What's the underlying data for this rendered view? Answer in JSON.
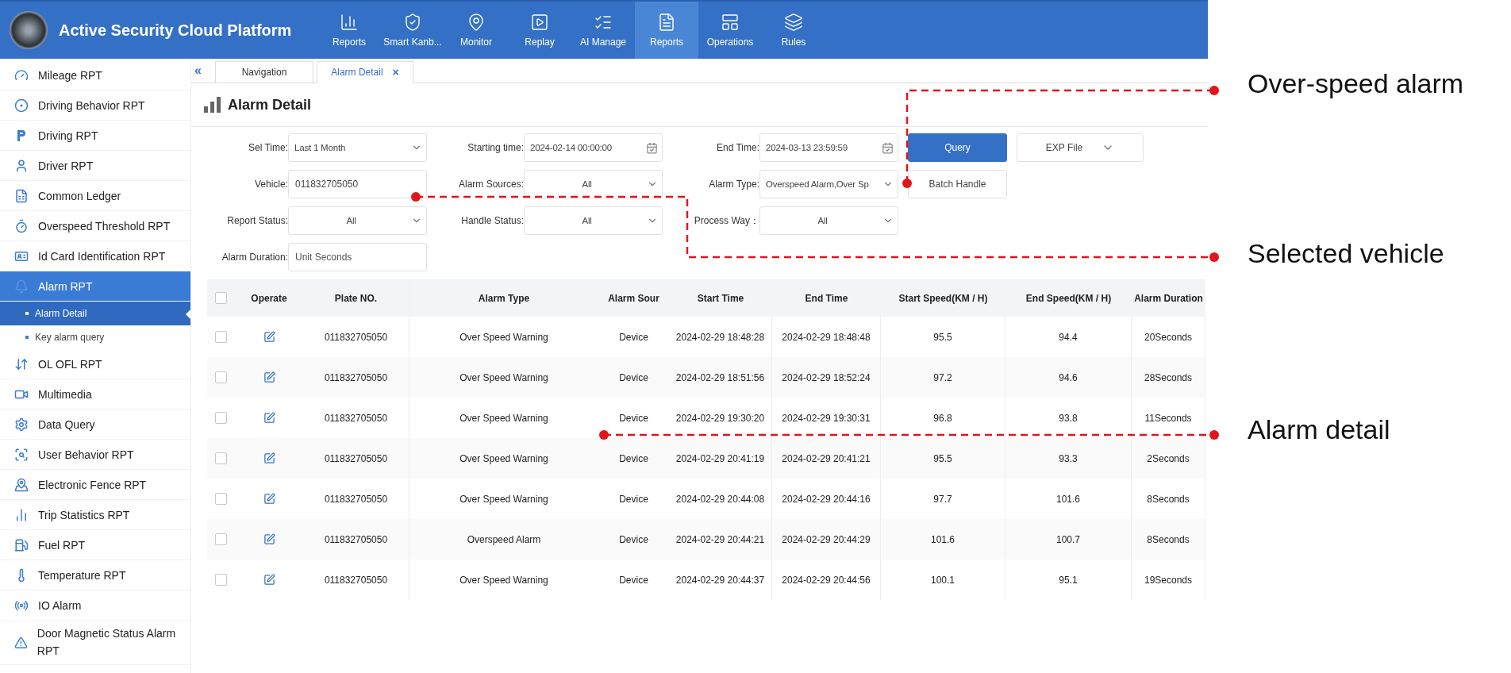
{
  "header": {
    "title": "Active Security Cloud Platform",
    "nav": [
      {
        "label": "Reports",
        "selected": false
      },
      {
        "label": "Smart Kanb...",
        "selected": false
      },
      {
        "label": "Monitor",
        "selected": false
      },
      {
        "label": "Replay",
        "selected": false
      },
      {
        "label": "AI Manage",
        "selected": false
      },
      {
        "label": "Reports",
        "selected": true
      },
      {
        "label": "Operations",
        "selected": false
      },
      {
        "label": "Rules",
        "selected": false
      }
    ]
  },
  "sidebar": {
    "items": [
      {
        "label": "Mileage RPT",
        "selected": false
      },
      {
        "label": "Driving Behavior RPT",
        "selected": false
      },
      {
        "label": "Driving RPT",
        "selected": false
      },
      {
        "label": "Driver RPT",
        "selected": false
      },
      {
        "label": "Common Ledger",
        "selected": false
      },
      {
        "label": "Overspeed Threshold RPT",
        "selected": false
      },
      {
        "label": "Id Card Identification RPT",
        "selected": false
      },
      {
        "label": "Alarm RPT",
        "selected": true,
        "children": [
          {
            "label": "Alarm Detail",
            "selected": true
          },
          {
            "label": "Key alarm query",
            "selected": false
          }
        ]
      },
      {
        "label": "OL OFL RPT",
        "selected": false
      },
      {
        "label": "Multimedia",
        "selected": false
      },
      {
        "label": "Data Query",
        "selected": false
      },
      {
        "label": "User Behavior RPT",
        "selected": false
      },
      {
        "label": "Electronic Fence RPT",
        "selected": false
      },
      {
        "label": "Trip Statistics RPT",
        "selected": false
      },
      {
        "label": "Fuel RPT",
        "selected": false
      },
      {
        "label": "Temperature RPT",
        "selected": false
      },
      {
        "label": "IO Alarm",
        "selected": false
      },
      {
        "label": "Door Magnetic Status Alarm RPT",
        "selected": false
      }
    ]
  },
  "tabs": {
    "collapse": "«",
    "items": [
      {
        "label": "Navigation",
        "selected": false
      },
      {
        "label": "Alarm Detail",
        "selected": true,
        "close": "×"
      }
    ]
  },
  "page_title": "Alarm Detail",
  "filter_rows": [
    {
      "fields": [
        {
          "label": "Sel Time:",
          "kind": "select",
          "value": "Last 1 Month",
          "centered": false
        },
        {
          "label": "Starting time:",
          "kind": "date",
          "value": "2024-02-14 00:00:00"
        },
        {
          "label": "End Time:",
          "kind": "date",
          "value": "2024-03-13 23:59:59"
        }
      ],
      "buttons": [
        {
          "label": "Query",
          "kind": "primary"
        },
        {
          "label": "EXP File",
          "kind": "dropdown"
        }
      ]
    },
    {
      "fields": [
        {
          "label": "Vehicle:",
          "kind": "input",
          "value": "011832705050"
        },
        {
          "label": "Alarm Sources:",
          "kind": "select",
          "value": "All",
          "centered": true
        },
        {
          "label": "Alarm Type:",
          "kind": "select",
          "value": "Overspeed Alarm,Over Sp",
          "centered": false
        }
      ],
      "buttons": [
        {
          "label": "Batch Handle",
          "kind": "plain"
        }
      ]
    },
    {
      "fields": [
        {
          "label": "Report Status:",
          "kind": "select",
          "value": "All",
          "centered": true
        },
        {
          "label": "Handle Status:",
          "kind": "select",
          "value": "All",
          "centered": true
        },
        {
          "label": "Process Way：",
          "kind": "select",
          "value": "All",
          "centered": true
        }
      ]
    },
    {
      "fields": [
        {
          "label": "Alarm Duration:",
          "kind": "input",
          "placeholder": "Unit Seconds"
        }
      ]
    }
  ],
  "table": {
    "all_checked": false,
    "operate_column": "Operate",
    "columns": [
      "Plate NO.",
      "Alarm Type",
      "Alarm Sour",
      "Start Time",
      "End Time",
      "Start Speed(KM / H)",
      "End Speed(KM / H)",
      "Alarm Duration"
    ],
    "rows": [
      {
        "checked": false,
        "cells": [
          "011832705050",
          "Over Speed Warning",
          "Device",
          "2024-02-29 18:48:28",
          "2024-02-29 18:48:48",
          "95.5",
          "94.4",
          "20Seconds"
        ]
      },
      {
        "checked": false,
        "cells": [
          "011832705050",
          "Over Speed Warning",
          "Device",
          "2024-02-29 18:51:56",
          "2024-02-29 18:52:24",
          "97.2",
          "94.6",
          "28Seconds"
        ]
      },
      {
        "checked": false,
        "cells": [
          "011832705050",
          "Over Speed Warning",
          "Device",
          "2024-02-29 19:30:20",
          "2024-02-29 19:30:31",
          "96.8",
          "93.8",
          "11Seconds"
        ]
      },
      {
        "checked": false,
        "cells": [
          "011832705050",
          "Over Speed Warning",
          "Device",
          "2024-02-29 20:41:19",
          "2024-02-29 20:41:21",
          "95.5",
          "93.3",
          "2Seconds"
        ]
      },
      {
        "checked": false,
        "cells": [
          "011832705050",
          "Over Speed Warning",
          "Device",
          "2024-02-29 20:44:08",
          "2024-02-29 20:44:16",
          "97.7",
          "101.6",
          "8Seconds"
        ]
      },
      {
        "checked": false,
        "cells": [
          "011832705050",
          "Overspeed Alarm",
          "Device",
          "2024-02-29 20:44:21",
          "2024-02-29 20:44:29",
          "101.6",
          "100.7",
          "8Seconds"
        ]
      },
      {
        "checked": false,
        "cells": [
          "011832705050",
          "Over Speed Warning",
          "Device",
          "2024-02-29 20:44:37",
          "2024-02-29 20:44:56",
          "100.1",
          "95.1",
          "19Seconds"
        ]
      }
    ]
  },
  "annotations": [
    {
      "label": "Over-speed alarm"
    },
    {
      "label": "Selected vehicle"
    },
    {
      "label": "Alarm detail"
    }
  ]
}
